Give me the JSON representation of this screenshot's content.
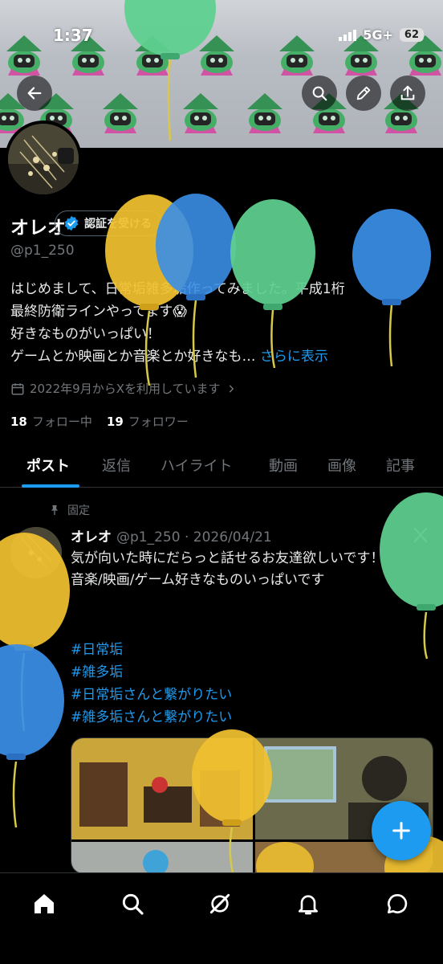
{
  "status_bar": {
    "time": "1:37",
    "network": "5G+",
    "battery": "62"
  },
  "profile": {
    "display_name": "オレオ",
    "verify_button_label": "認証を受ける",
    "handle": "@p1_250",
    "bio_lines": [
      "はじめまして、日常垢雑多垢作ってみました。平成1桁",
      "最終防衛ラインやってます😱",
      "好きなものがいっぱい！",
      "ゲームとか映画とか音楽とか好きなも…"
    ],
    "bio_more": "さらに表示",
    "joined": "2022年9月からXを利用しています",
    "following_count": "18",
    "following_label": "フォロー中",
    "followers_count": "19",
    "followers_label": "フォロワー"
  },
  "tabs": [
    {
      "label": "ポスト",
      "active": true
    },
    {
      "label": "返信"
    },
    {
      "label": "ハイライト"
    },
    {
      "label": "動画"
    },
    {
      "label": "画像"
    },
    {
      "label": "記事"
    }
  ],
  "post": {
    "pinned_label": "固定",
    "author": "オレオ",
    "meta": "@p1_250 · 2026/04/21",
    "body_lines": [
      "気が向いた時にだらっと話せるお友達欲しいです！",
      "音楽/映画/ゲーム好きなものいっぱいです"
    ],
    "hashtags": [
      "#日常垢",
      "#雑多垢",
      "#日常垢さんと繋がりたい",
      "#雑多垢さんと繋がりたい"
    ]
  },
  "icons": {
    "back": "arrow-left-icon",
    "search": "search-icon",
    "edit": "pencil-icon",
    "share": "share-icon",
    "calendar": "calendar-icon",
    "pin": "pin-icon",
    "compose": "plus-icon",
    "nav": [
      "home-icon",
      "search-icon",
      "grok-icon",
      "bell-icon",
      "messages-icon"
    ]
  },
  "colors": {
    "accent": "#1d9bf0",
    "muted": "#71767b",
    "background": "#000000"
  }
}
